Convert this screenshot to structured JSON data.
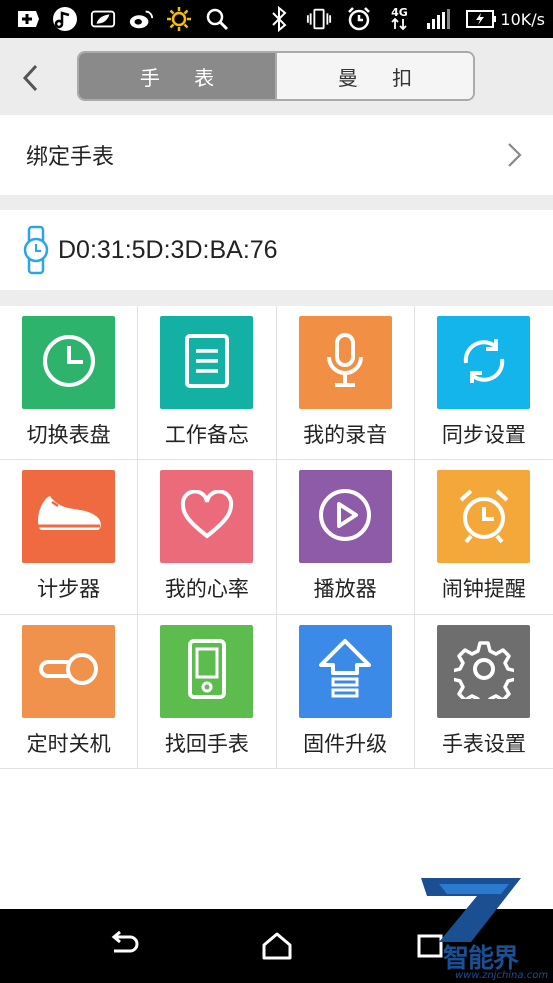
{
  "status_bar": {
    "network_label": "4G",
    "speed": "10K/s",
    "icons": [
      "plus-notification-icon",
      "music-icon",
      "leaf-icon",
      "weibo-icon",
      "brightness-icon",
      "search-icon",
      "bluetooth-icon",
      "vibrate-icon",
      "alarm-icon",
      "4g-data-icon",
      "signal-icon",
      "battery-icon"
    ]
  },
  "header": {
    "tabs": [
      {
        "label": "手 表",
        "active": true
      },
      {
        "label": "曼 扣",
        "active": false
      }
    ]
  },
  "bind": {
    "label": "绑定手表"
  },
  "device": {
    "mac": "D0:31:5D:3D:BA:76"
  },
  "grid": [
    {
      "label": "切换表盘",
      "icon": "clock-icon",
      "color": "#2db36c"
    },
    {
      "label": "工作备忘",
      "icon": "memo-icon",
      "color": "#12b1a3"
    },
    {
      "label": "我的录音",
      "icon": "microphone-icon",
      "color": "#f18f45"
    },
    {
      "label": "同步设置",
      "icon": "sync-icon",
      "color": "#13b5ea"
    },
    {
      "label": "计步器",
      "icon": "shoe-icon",
      "color": "#ef6a40"
    },
    {
      "label": "我的心率",
      "icon": "heart-icon",
      "color": "#ec6b7a"
    },
    {
      "label": "播放器",
      "icon": "play-icon",
      "color": "#8d5ba7"
    },
    {
      "label": "闹钟提醒",
      "icon": "alarm-clock-icon",
      "color": "#f5a83a"
    },
    {
      "label": "定时关机",
      "icon": "toggle-icon",
      "color": "#f0914c"
    },
    {
      "label": "找回手表",
      "icon": "phone-icon",
      "color": "#5cbd4e"
    },
    {
      "label": "固件升级",
      "icon": "upgrade-icon",
      "color": "#3b8ae8"
    },
    {
      "label": "手表设置",
      "icon": "gear-icon",
      "color": "#6e6e6e"
    }
  ],
  "watermark": {
    "brand": "智能界",
    "url": "www.znjchina.com"
  }
}
